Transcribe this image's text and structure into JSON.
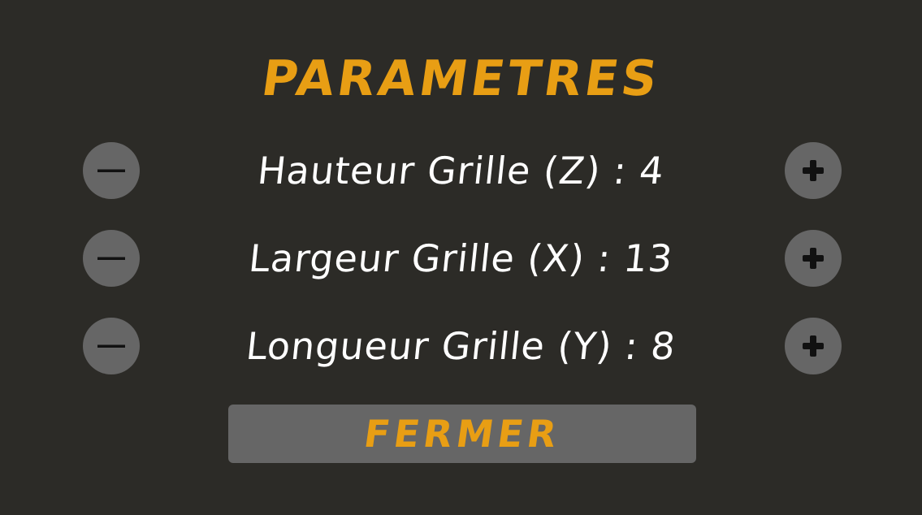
{
  "title": "PARAMETRES",
  "settings": [
    {
      "label": "Hauteur Grille (Z) : 4",
      "decrement_icon": "minus-icon",
      "increment_icon": "plus-icon"
    },
    {
      "label": "Largeur Grille (X) : 13",
      "decrement_icon": "minus-icon",
      "increment_icon": "plus-icon"
    },
    {
      "label": "Longueur Grille (Y) : 8",
      "decrement_icon": "minus-icon",
      "increment_icon": "plus-icon"
    }
  ],
  "close_button": {
    "label": "FERMER"
  },
  "colors": {
    "background": "#2c2b27",
    "accent": "#e89e14",
    "button": "#666666",
    "text": "#ffffff"
  }
}
